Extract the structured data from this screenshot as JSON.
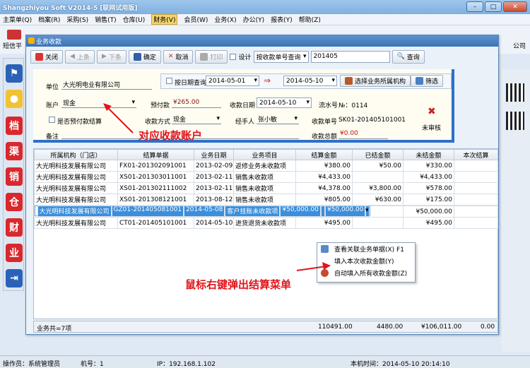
{
  "app": {
    "title": "Shangzhiyou Soft V2014-5 [联网试用版]",
    "win_buttons": [
      "–",
      "□",
      "✕"
    ]
  },
  "menu": [
    "主菜单(Q)",
    "档案(R)",
    "采购(S)",
    "销售(T)",
    "仓库(U)",
    "财务(V)",
    "会员(W)",
    "业务(X)",
    "办公(Y)",
    "报表(Y)",
    "帮助(Z)"
  ],
  "bg": {
    "sms_label": "短信平",
    "company_tail": "公司",
    "side_chars": [
      "档",
      "渠",
      "销",
      "仓",
      "财",
      "业"
    ]
  },
  "dialog": {
    "title": "业务收款",
    "toolbar": {
      "close": "关闭",
      "prev": "上条",
      "next": "下条",
      "confirm": "确定",
      "cancel": "取消",
      "print": "打印",
      "design": "设计",
      "query_type": "按收款单号查询",
      "query_value": "201405",
      "query_btn": "查询"
    },
    "form": {
      "unit_label": "单位",
      "unit_value": "大光明电业有限公司",
      "date_query_label": "按日期查询",
      "date_from": "2014-05-01",
      "date_to": "2014-05-10",
      "select_org_btn": "选择业务所属机构",
      "filter_btn": "筛选",
      "account_label": "账户",
      "account_value": "现金",
      "prepay_label": "预付款",
      "prepay_value": "¥265.00",
      "recv_date_label": "收款日期",
      "recv_date_value": "2014-05-10",
      "serial_label": "流水号",
      "serial_value": "№：0114",
      "prepay_settle_label": "是否预付款结算",
      "method_label": "收款方式",
      "method_value": "现金",
      "handler_label": "经手人",
      "handler_value": "张小敏",
      "recv_no_label": "收款单号",
      "recv_no_value": "SK01-201405101001",
      "unaudited": "未审核",
      "remark_label": "备注",
      "total_label": "收款总额",
      "total_value": "¥0.00"
    },
    "table": {
      "headers": [
        "所属机构（门店）",
        "结算单据",
        "业务日期",
        "业务项目",
        "结算金额",
        "已结金额",
        "未结金额",
        "本次结算"
      ],
      "rows": [
        [
          "大光明科技发展有限公司",
          "FX01-201302091001",
          "2013-02-09",
          "返修业务未收款项",
          "¥380.00",
          "¥50.00",
          "¥330.00",
          ""
        ],
        [
          "大光明科技发展有限公司",
          "XS01-201303011001",
          "2013-02-11",
          "销售未收款项",
          "¥4,433.00",
          "",
          "¥4,433.00",
          ""
        ],
        [
          "大光明科技发展有限公司",
          "XS01-201302111002",
          "2013-02-11",
          "销售未收款项",
          "¥4,378.00",
          "¥3,800.00",
          "¥578.00",
          ""
        ],
        [
          "大光明科技发展有限公司",
          "XS01-201308121001",
          "2013-08-12",
          "销售未收款项",
          "¥805.00",
          "¥630.00",
          "¥175.00",
          ""
        ],
        [
          "大光明科技发展有限公司",
          "GZ01-201405081001",
          "2014-05-08",
          "客户挂账未收款项",
          "¥50,000.00",
          "",
          "¥50,000.00",
          ""
        ],
        [
          "大光明科技发展有限公司",
          "XS01-201405081001",
          "2014-05-08",
          "销售未收款项",
          "¥50,000.00",
          "",
          "¥50,000.00",
          ""
        ],
        [
          "大光明科技发展有限公司",
          "CT01-201405101001",
          "2014-05-10",
          "进货退货未收款项",
          "¥495.00",
          "",
          "¥495.00",
          ""
        ]
      ],
      "selected_row": 4
    },
    "footer": {
      "count": "业务共=7项",
      "sum_settle": "110491.00",
      "sum_done": "4480.00",
      "sum_undone": "¥106,011.00",
      "sum_now": "0.00"
    },
    "context_menu": [
      "查看关联业务单据(X)  F1",
      "填入本次收款金额(Y)",
      "自动填入所有收款金额(Z)"
    ]
  },
  "annotations": {
    "account": "对应收款账户",
    "rightclick": "鼠标右键弹出结算菜单"
  },
  "status": {
    "operator": "操作员：系统管理员",
    "machine": "机号：1",
    "ip": "IP：192.168.1.102",
    "time": "本机时间：2014-05-10 20:14:10"
  }
}
